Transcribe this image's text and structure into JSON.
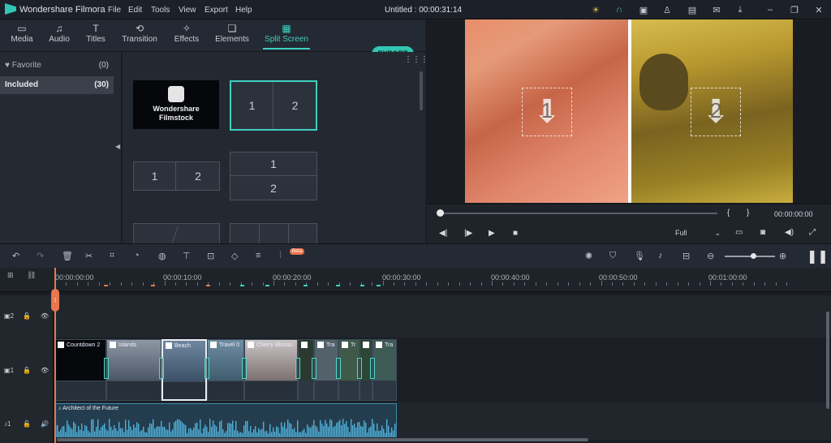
{
  "app": {
    "name": "Wondershare Filmora",
    "window_title": "Untitled : 00:00:31:14"
  },
  "menu": [
    "File",
    "Edit",
    "Tools",
    "View",
    "Export",
    "Help"
  ],
  "title_icons": [
    "bulb-icon",
    "headset-icon",
    "gift-icon",
    "account-icon",
    "save-icon",
    "mail-icon",
    "download-icon",
    "minimize-icon",
    "restore-icon",
    "close-icon"
  ],
  "tabs": [
    {
      "label": "Media",
      "icon": "folder-icon"
    },
    {
      "label": "Audio",
      "icon": "music-icon"
    },
    {
      "label": "Titles",
      "icon": "text-icon"
    },
    {
      "label": "Transition",
      "icon": "transition-icon"
    },
    {
      "label": "Effects",
      "icon": "effects-icon"
    },
    {
      "label": "Elements",
      "icon": "elements-icon"
    },
    {
      "label": "Split Screen",
      "icon": "split-screen-icon",
      "active": true
    }
  ],
  "export_label": "EXPORT",
  "sidebar": {
    "items": [
      {
        "label": "Favorite",
        "count": "(0)",
        "icon": "heart-icon"
      },
      {
        "label": "Included",
        "count": "(30)",
        "selected": true
      }
    ]
  },
  "library": {
    "filmstock": {
      "line1": "Wondershare",
      "line2": "Filmstock"
    },
    "templates": [
      {
        "cells": [
          "1",
          "2"
        ],
        "selected": true
      },
      {
        "cells": [
          "1",
          "2"
        ]
      },
      {
        "cells": [
          "1",
          "2"
        ]
      }
    ]
  },
  "preview": {
    "drop_zones": [
      "1",
      "2"
    ],
    "time": "00:00:00:00",
    "quality": "Full",
    "controls": [
      "prev-frame-icon",
      "play-pause-icon",
      "play-icon",
      "stop-icon"
    ],
    "markers": [
      "{",
      "}"
    ]
  },
  "ruler": [
    "00:00:00:00",
    "00:00:10:00",
    "00:00:20:00",
    "00:00:30:00",
    "00:00:40:00",
    "00:00:50:00",
    "00:01:00:00"
  ],
  "tracks": {
    "video2": {
      "label": "2"
    },
    "video1": {
      "label": "1"
    },
    "audio1": {
      "label": "1"
    }
  },
  "clips": [
    {
      "label": "Countdown 2"
    },
    {
      "label": "Islands"
    },
    {
      "label": "Beach"
    },
    {
      "label": "Travel 0"
    },
    {
      "label": "Cherry Blosso"
    },
    {
      "label": ""
    },
    {
      "label": "Tra"
    },
    {
      "label": "Tr"
    },
    {
      "label": ""
    },
    {
      "label": "Tra"
    }
  ],
  "audio_clip": {
    "label": "Architect of the Future"
  },
  "toolbar_badge": "Beta",
  "colors": {
    "accent": "#3fd0c0",
    "playhead": "#e8774e",
    "export_bg": "#33c7b3"
  }
}
